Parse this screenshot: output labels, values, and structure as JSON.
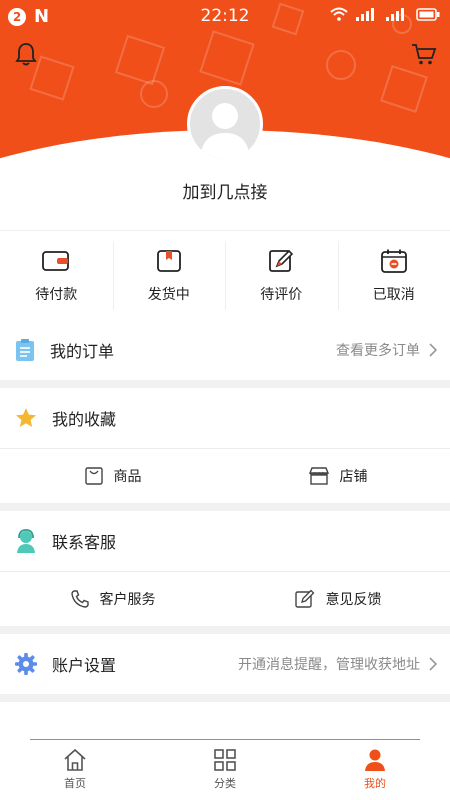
{
  "statusbar": {
    "badge": "2",
    "n_icon": "N",
    "time": "22:12"
  },
  "header": {
    "username": "加到几点接",
    "bell_icon": "bell-icon",
    "cart_icon": "cart-icon"
  },
  "order_status": [
    {
      "label": "待付款",
      "icon": "wallet-icon"
    },
    {
      "label": "发货中",
      "icon": "package-icon"
    },
    {
      "label": "待评价",
      "icon": "review-edit-icon"
    },
    {
      "label": "已取消",
      "icon": "calendar-cancel-icon"
    }
  ],
  "my_orders": {
    "title": "我的订单",
    "more": "查看更多订单"
  },
  "favorites": {
    "title": "我的收藏",
    "items": [
      "商品",
      "店铺"
    ]
  },
  "service": {
    "title": "联系客服",
    "items": [
      "客户服务",
      "意见反馈"
    ]
  },
  "settings": {
    "title": "账户设置",
    "hint": "开通消息提醒，管理收获地址"
  },
  "tabbar": {
    "tabs": [
      {
        "label": "首页",
        "icon": "home-icon"
      },
      {
        "label": "分类",
        "icon": "grid-icon"
      },
      {
        "label": "我的",
        "icon": "user-icon"
      }
    ],
    "active": "我的"
  },
  "colors": {
    "accent": "#f04f1a",
    "order_icon_red": "#e8502a",
    "star": "#f5b731",
    "gear": "#5b8de8",
    "clipboard": "#7cc4f0",
    "support": "#4ec9b8"
  }
}
